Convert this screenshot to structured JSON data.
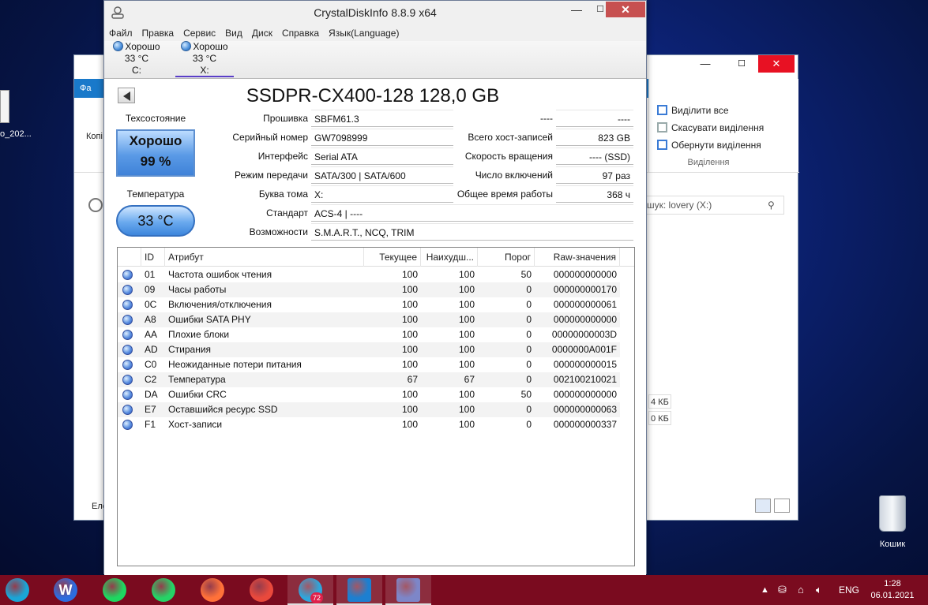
{
  "desktop": {
    "icon_label": "o_202...",
    "recycle_label": "Кошик"
  },
  "explorer": {
    "ribbon": {
      "select_all": "Виділити все",
      "deselect": "Скасувати виділення",
      "invert": "Обернути виділення",
      "group": "Виділення"
    },
    "search_placeholder": "шук: lovery (X:)",
    "sizes": [
      "4 КБ",
      "0 КБ"
    ],
    "left_labels": [
      "Фа",
      "Копі",
      "Еле"
    ],
    "min": "—",
    "max": "☐",
    "close": "✕"
  },
  "cdi": {
    "title": "CrystalDiskInfo 8.8.9 x64",
    "menu": [
      "Файл",
      "Правка",
      "Сервис",
      "Вид",
      "Диск",
      "Справка",
      "Язык(Language)"
    ],
    "disks": [
      {
        "status": "Хорошо",
        "temp": "33 °C",
        "letter": "C:"
      },
      {
        "status": "Хорошо",
        "temp": "33 °C",
        "letter": "X:"
      }
    ],
    "model": "SSDPR-CX400-128 128,0 GB",
    "health_label": "Техсостояние",
    "health_status": "Хорошо",
    "health_pct": "99 %",
    "temp_label": "Температура",
    "temp_value": "33 °C",
    "fields_left": [
      {
        "label": "Прошивка",
        "value": "SBFM61.3"
      },
      {
        "label": "Серийный номер",
        "value": "GW7098999"
      },
      {
        "label": "Интерфейс",
        "value": "Serial ATA"
      },
      {
        "label": "Режим передачи",
        "value": "SATA/300 | SATA/600"
      },
      {
        "label": "Буква тома",
        "value": "X:"
      },
      {
        "label": "Стандарт",
        "value": "ACS-4 | ----"
      },
      {
        "label": "Возможности",
        "value": "S.M.A.R.T., NCQ, TRIM"
      }
    ],
    "fields_right": [
      {
        "label": "----",
        "value": "----"
      },
      {
        "label": "Всего хост-записей",
        "value": "823 GB"
      },
      {
        "label": "Скорость вращения",
        "value": "---- (SSD)"
      },
      {
        "label": "Число включений",
        "value": "97 раз"
      },
      {
        "label": "Общее время работы",
        "value": "368 ч"
      }
    ],
    "table": {
      "headers": [
        "ID",
        "Атрибут",
        "Текущее",
        "Наихудш...",
        "Порог",
        "Raw-значения"
      ],
      "rows": [
        [
          "01",
          "Частота ошибок чтения",
          "100",
          "100",
          "50",
          "000000000000"
        ],
        [
          "09",
          "Часы работы",
          "100",
          "100",
          "0",
          "000000000170"
        ],
        [
          "0C",
          "Включения/отключения",
          "100",
          "100",
          "0",
          "000000000061"
        ],
        [
          "A8",
          "Ошибки SATA PHY",
          "100",
          "100",
          "0",
          "000000000000"
        ],
        [
          "AA",
          "Плохие блоки",
          "100",
          "100",
          "0",
          "00000000003D"
        ],
        [
          "AD",
          "Стирания",
          "100",
          "100",
          "0",
          "0000000A001F"
        ],
        [
          "C0",
          "Неожиданные потери питания",
          "100",
          "100",
          "0",
          "000000000015"
        ],
        [
          "C2",
          "Температура",
          "67",
          "67",
          "0",
          "002100210021"
        ],
        [
          "DA",
          "Ошибки CRC",
          "100",
          "100",
          "50",
          "000000000000"
        ],
        [
          "E7",
          "Оставшийся ресурс SSD",
          "100",
          "100",
          "0",
          "000000000063"
        ],
        [
          "F1",
          "Хост-записи",
          "100",
          "100",
          "0",
          "000000000337"
        ]
      ]
    }
  },
  "taskbar": {
    "apps": [
      {
        "icon": "edge-icon",
        "color": "#1aa5d6"
      },
      {
        "icon": "wps-writer-icon",
        "color": "#2d6cdf",
        "glyph": "W"
      },
      {
        "icon": "spotify-icon",
        "color": "#1ed760"
      },
      {
        "icon": "whatsapp-icon",
        "color": "#25d366"
      },
      {
        "icon": "firefox-icon",
        "color": "#ff7139"
      },
      {
        "icon": "chrome-icon",
        "color": "#e9493c"
      },
      {
        "icon": "telegram-icon",
        "color": "#2ea6dc"
      },
      {
        "icon": "photos-icon",
        "color": "#1d7fd0"
      },
      {
        "icon": "crystaldiskinfo-icon",
        "color": "#7d86c8"
      }
    ],
    "telegram_badge": "72",
    "lang": "ENG",
    "time": "1:28",
    "date": "06.01.2021"
  }
}
